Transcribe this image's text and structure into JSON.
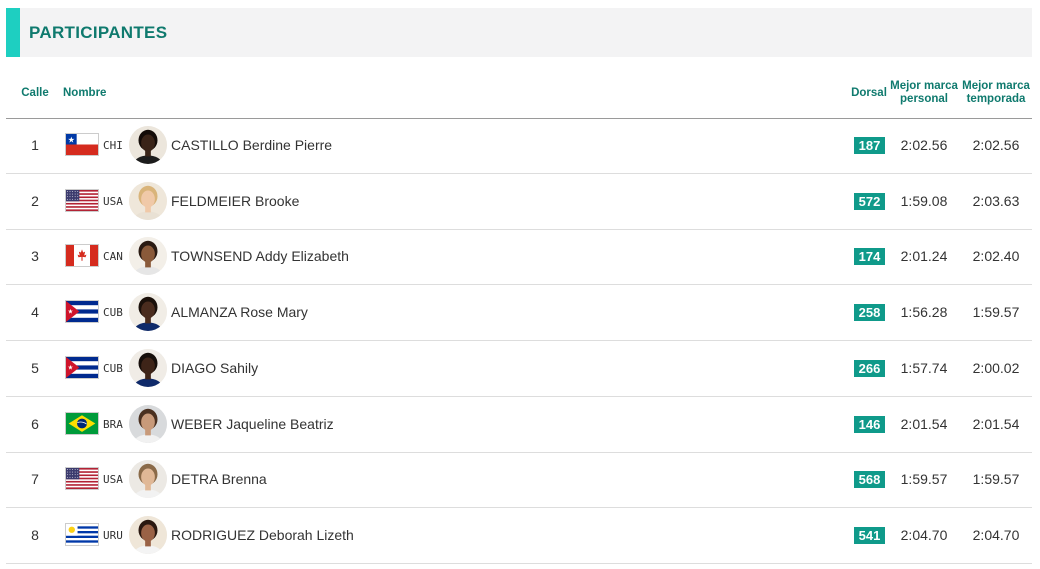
{
  "section": {
    "title": "PARTICIPANTES"
  },
  "columns": {
    "lane": "Calle",
    "name": "Nombre",
    "bib": "Dorsal",
    "pb_line1": "Mejor marca",
    "pb_line2": "personal",
    "sb_line1": "Mejor marca",
    "sb_line2": "temporada"
  },
  "participants": [
    {
      "lane": "1",
      "country": "CHI",
      "name": "CASTILLO Berdine Pierre",
      "bib": "187",
      "pb": "2:02.56",
      "sb": "2:02.56"
    },
    {
      "lane": "2",
      "country": "USA",
      "name": "FELDMEIER Brooke",
      "bib": "572",
      "pb": "1:59.08",
      "sb": "2:03.63"
    },
    {
      "lane": "3",
      "country": "CAN",
      "name": "TOWNSEND Addy Elizabeth",
      "bib": "174",
      "pb": "2:01.24",
      "sb": "2:02.40"
    },
    {
      "lane": "4",
      "country": "CUB",
      "name": "ALMANZA Rose Mary",
      "bib": "258",
      "pb": "1:56.28",
      "sb": "1:59.57"
    },
    {
      "lane": "5",
      "country": "CUB",
      "name": "DIAGO Sahily",
      "bib": "266",
      "pb": "1:57.74",
      "sb": "2:00.02"
    },
    {
      "lane": "6",
      "country": "BRA",
      "name": "WEBER Jaqueline Beatriz",
      "bib": "146",
      "pb": "2:01.54",
      "sb": "2:01.54"
    },
    {
      "lane": "7",
      "country": "USA",
      "name": "DETRA Brenna",
      "bib": "568",
      "pb": "1:59.57",
      "sb": "1:59.57"
    },
    {
      "lane": "8",
      "country": "URU",
      "name": "RODRIGUEZ Deborah Lizeth",
      "bib": "541",
      "pb": "2:04.70",
      "sb": "2:04.70"
    }
  ],
  "icons": {
    "flags": [
      "chile-flag-icon",
      "usa-flag-icon",
      "canada-flag-icon",
      "cuba-flag-icon",
      "brazil-flag-icon",
      "uruguay-flag-icon"
    ],
    "avatar": "athlete-photo"
  },
  "colors": {
    "accent": "#1ecfc1",
    "title": "#0f7a6e",
    "bib_bg": "#0f9a8a",
    "header_bg": "#f3f3f4"
  }
}
